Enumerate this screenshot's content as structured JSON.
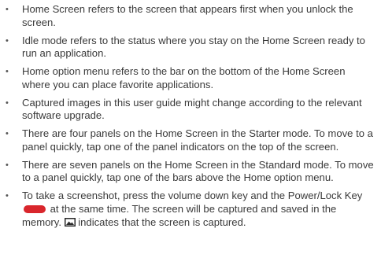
{
  "bullet_symbol": "•",
  "items": [
    "Home Screen refers to the screen that appears first when you unlock the screen.",
    "Idle mode refers to the status where you stay on the Home Screen ready to run an application.",
    "Home option menu refers to the bar on the bottom of the Home Screen where you can place favorite applications.",
    "Captured images in this user guide might change according to the relevant software upgrade.",
    "There are four panels on the Home Screen in the Starter mode. To move to a panel quickly, tap one of the panel indicators on the top of the screen.",
    "There are seven panels on the Home Screen in the Standard mode. To move to a panel quickly, tap one of the bars above the Home option menu."
  ],
  "screenshot_item": {
    "part1": "To take a screenshot, press the volume down key and the Power/Lock Key",
    "part2": "at the same time. The screen will be captured and saved in the memory.",
    "part3": "indicates that the screen is captured.",
    "key_icon": "power-lock-key-icon",
    "key_color": "#d9262c",
    "capture_icon": "screenshot-captured-icon"
  }
}
